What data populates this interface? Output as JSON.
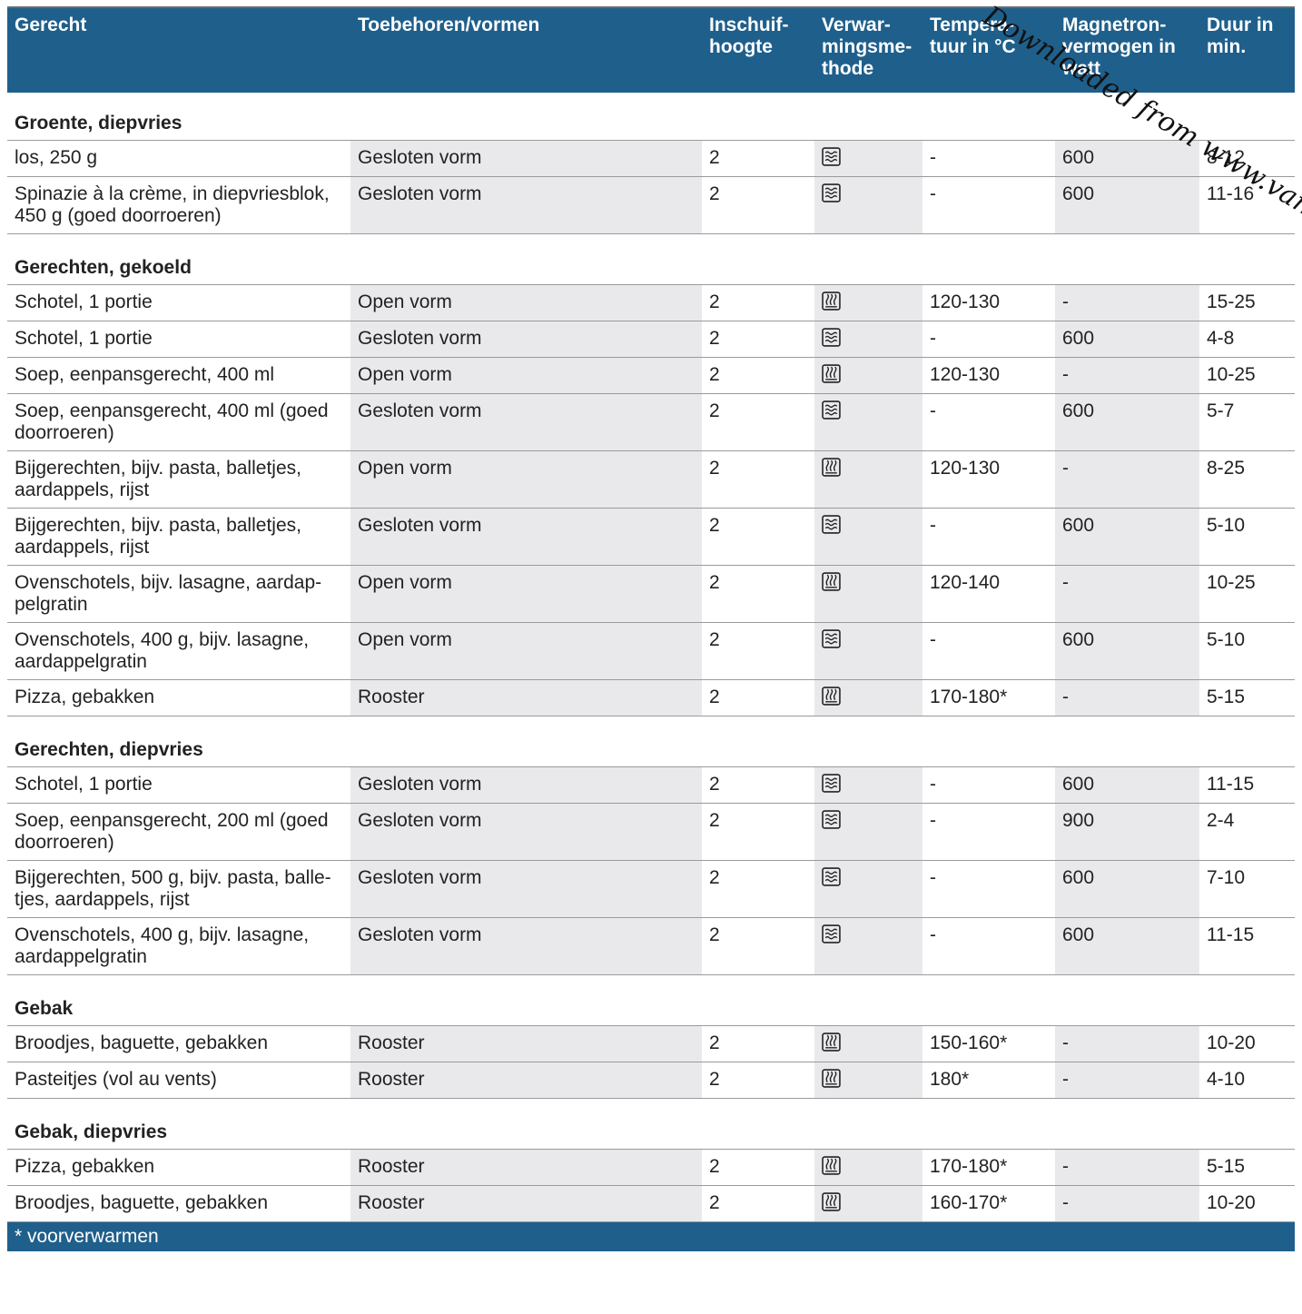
{
  "headers": {
    "dish": "Gerecht",
    "accessories": "Toebehoren/vormen",
    "level_l1": "Inschuif-",
    "level_l2": "hoogte",
    "method_l1": "Verwar-",
    "method_l2": "mingsme-",
    "method_l3": "thode",
    "temp_l1": "Tempera-",
    "temp_l2": "tuur in °C",
    "power_l1": "Magnetron-",
    "power_l2": "vermogen in",
    "power_l3": "watt",
    "duration_l1": "Duur in",
    "duration_l2": "min."
  },
  "icons": {
    "microwave": "microwave-waves-icon",
    "hotair": "hot-air-steam-icon"
  },
  "sections": [
    {
      "title": "Groente, diepvries",
      "rows": [
        {
          "dish": "los, 250 g",
          "acc": "Gesloten vorm",
          "level": "2",
          "method": "microwave",
          "temp": "-",
          "power": "600",
          "duration": "8-12"
        },
        {
          "dish": "Spinazie à la crème, in diepvriesblok, 450 g (goed doorroeren)",
          "acc": "Gesloten vorm",
          "level": "2",
          "method": "microwave",
          "temp": "-",
          "power": "600",
          "duration": "11-16"
        }
      ]
    },
    {
      "title": "Gerechten, gekoeld",
      "rows": [
        {
          "dish": "Schotel, 1 portie",
          "acc": "Open vorm",
          "level": "2",
          "method": "hotair",
          "temp": "120-130",
          "power": "-",
          "duration": "15-25"
        },
        {
          "dish": "Schotel, 1 portie",
          "acc": "Gesloten vorm",
          "level": "2",
          "method": "microwave",
          "temp": "-",
          "power": "600",
          "duration": "4-8"
        },
        {
          "dish": "Soep, eenpansgerecht, 400 ml",
          "acc": "Open vorm",
          "level": "2",
          "method": "hotair",
          "temp": "120-130",
          "power": "-",
          "duration": "10-25"
        },
        {
          "dish": "Soep, eenpansgerecht, 400 ml (goed doorroeren)",
          "acc": "Gesloten vorm",
          "level": "2",
          "method": "microwave",
          "temp": "-",
          "power": "600",
          "duration": "5-7"
        },
        {
          "dish": "Bijgerechten, bijv. pasta, balletjes, aardappels, rijst",
          "acc": "Open vorm",
          "level": "2",
          "method": "hotair",
          "temp": "120-130",
          "power": "-",
          "duration": "8-25"
        },
        {
          "dish": "Bijgerechten, bijv. pasta, balletjes, aardappels, rijst",
          "acc": "Gesloten vorm",
          "level": "2",
          "method": "microwave",
          "temp": "-",
          "power": "600",
          "duration": "5-10"
        },
        {
          "dish": "Ovenschotels, bijv. lasagne, aardap-pelgratin",
          "acc": "Open vorm",
          "level": "2",
          "method": "hotair",
          "temp": "120-140",
          "power": "-",
          "duration": "10-25"
        },
        {
          "dish": "Ovenschotels, 400 g, bijv. lasagne, aardappelgratin",
          "acc": "Open vorm",
          "level": "2",
          "method": "microwave",
          "temp": "-",
          "power": "600",
          "duration": "5-10"
        },
        {
          "dish": "Pizza, gebakken",
          "acc": "Rooster",
          "level": "2",
          "method": "hotair",
          "temp": "170-180*",
          "power": "-",
          "duration": "5-15"
        }
      ]
    },
    {
      "title": "Gerechten, diepvries",
      "rows": [
        {
          "dish": "Schotel, 1 portie",
          "acc": "Gesloten vorm",
          "level": "2",
          "method": "microwave",
          "temp": "-",
          "power": "600",
          "duration": "11-15"
        },
        {
          "dish": "Soep, eenpansgerecht, 200 ml (goed doorroeren)",
          "acc": "Gesloten vorm",
          "level": "2",
          "method": "microwave",
          "temp": "-",
          "power": "900",
          "duration": "2-4"
        },
        {
          "dish": "Bijgerechten, 500 g, bijv. pasta, balle-tjes, aardappels, rijst",
          "acc": "Gesloten vorm",
          "level": "2",
          "method": "microwave",
          "temp": "-",
          "power": "600",
          "duration": "7-10"
        },
        {
          "dish": "Ovenschotels, 400 g, bijv. lasagne, aardappelgratin",
          "acc": "Gesloten vorm",
          "level": "2",
          "method": "microwave",
          "temp": "-",
          "power": "600",
          "duration": "11-15"
        }
      ]
    },
    {
      "title": "Gebak",
      "rows": [
        {
          "dish": "Broodjes, baguette, gebakken",
          "acc": "Rooster",
          "level": "2",
          "method": "hotair",
          "temp": "150-160*",
          "power": "-",
          "duration": "10-20"
        },
        {
          "dish": "Pasteitjes (vol au vents)",
          "acc": "Rooster",
          "level": "2",
          "method": "hotair",
          "temp": "180*",
          "power": "-",
          "duration": "4-10"
        }
      ]
    },
    {
      "title": "Gebak, diepvries",
      "rows": [
        {
          "dish": "Pizza, gebakken",
          "acc": "Rooster",
          "level": "2",
          "method": "hotair",
          "temp": "170-180*",
          "power": "-",
          "duration": "5-15"
        },
        {
          "dish": "Broodjes, baguette, gebakken",
          "acc": "Rooster",
          "level": "2",
          "method": "hotair",
          "temp": "160-170*",
          "power": "-",
          "duration": "10-20"
        }
      ]
    }
  ],
  "footnote": "* voorverwarmen",
  "watermark": "Downloaded from www.vandenborre.be",
  "colors": {
    "header_bg": "#1f5f8b",
    "stripe_bg": "#e9e9ec"
  }
}
